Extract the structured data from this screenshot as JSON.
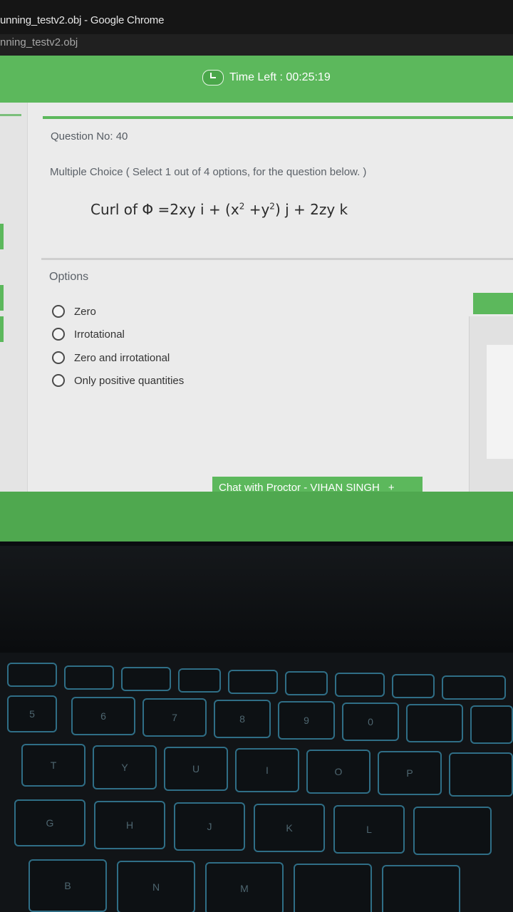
{
  "window": {
    "title": "unning_testv2.obj - Google Chrome",
    "address": "nning_testv2.obj"
  },
  "header": {
    "timer_label": "Time Left : 00:25:19"
  },
  "question": {
    "number_label": "Question No: 40",
    "type_label": "Multiple Choice ( Select 1 out of 4 options, for the question below. )",
    "text_prefix": "Curl of Φ =2xy i  + (x",
    "sup1": "2",
    "text_mid": " +y",
    "sup2": "2",
    "text_suffix": ") j  + 2zy k"
  },
  "options": {
    "label": "Options",
    "items": [
      {
        "label": "Zero"
      },
      {
        "label": "Irrotational"
      },
      {
        "label": "Zero and irrotational"
      },
      {
        "label": "Only positive quantities"
      }
    ]
  },
  "chat": {
    "label": "Chat with Proctor - VIHAN SINGH",
    "plus": "+"
  },
  "colors": {
    "accent": "#5cb85c",
    "keyboard_backlight": "#2f6e86"
  },
  "keyboard": {
    "keys": [
      "5",
      "6",
      "7",
      "8",
      "9",
      "0",
      "T",
      "Y",
      "U",
      "I",
      "O",
      "P",
      "G",
      "H",
      "J",
      "K",
      "L",
      "B",
      "N",
      "M"
    ]
  }
}
